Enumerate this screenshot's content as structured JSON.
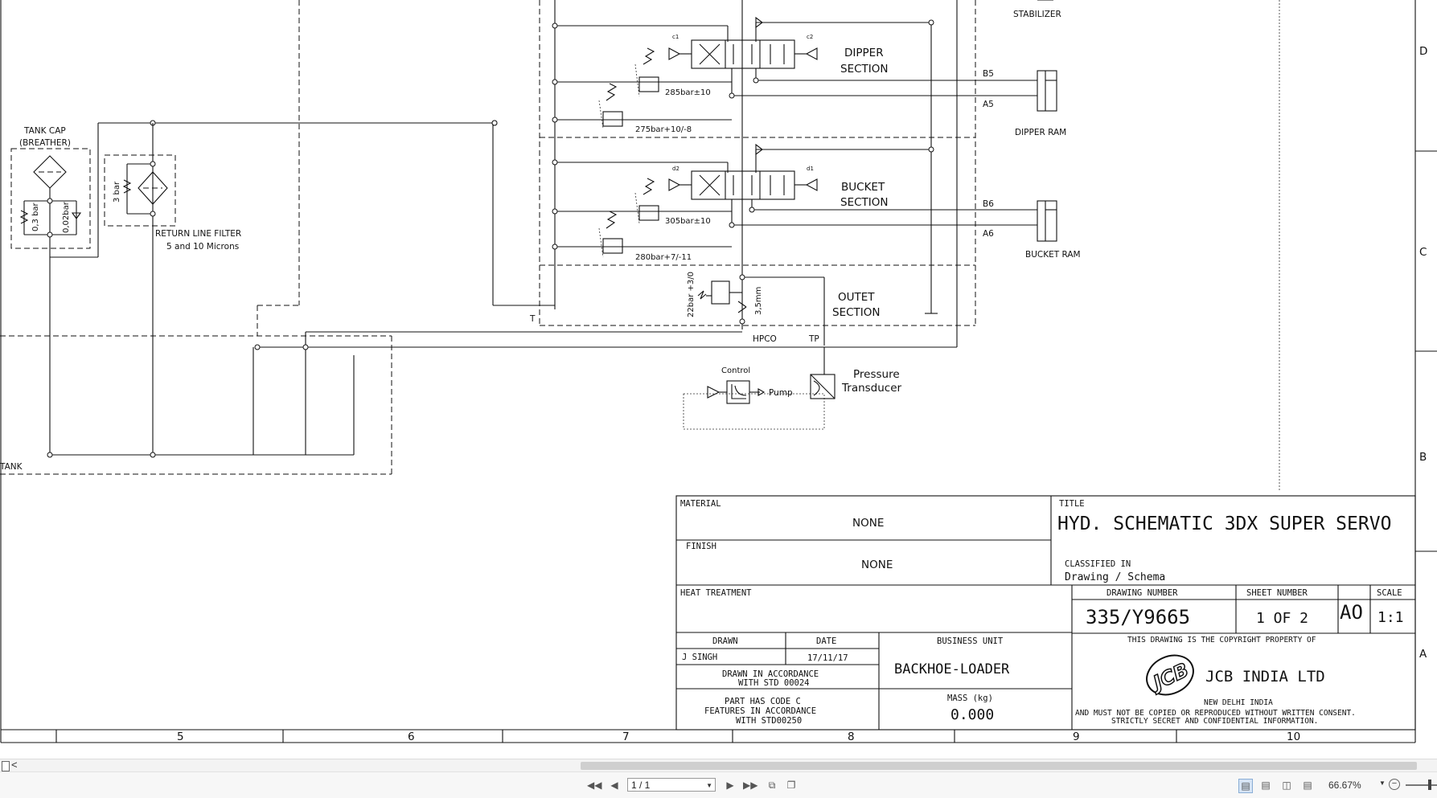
{
  "schematic": {
    "labels": {
      "stabilizer": "STABILIZER",
      "dipper_section": [
        "DIPPER",
        "SECTION"
      ],
      "bucket_section": [
        "BUCKET",
        "SECTION"
      ],
      "outet_section": [
        "OUTET",
        "SECTION"
      ],
      "b5": "B5",
      "a5": "A5",
      "b6": "B6",
      "a6": "A6",
      "dipper_ram": "DIPPER   RAM",
      "bucket_ram": "BUCKET   RAM",
      "relief_285": "285bar±10",
      "relief_275": "275bar+10/-8",
      "relief_305": "305bar±10",
      "relief_280": "280bar+7/-11",
      "relief_22": "22bar +3/0",
      "orifice": "3,5mm",
      "c1": "c1",
      "c2": "c2",
      "d1": "d1",
      "d2": "d2",
      "t_port": "T",
      "hpco": "HPCO",
      "tp": "TP",
      "control": "Control",
      "pump": "Pump",
      "pressure_transducer": [
        "Pressure",
        "Transducer"
      ],
      "tank_cap": [
        "TANK   CAP",
        "(BREATHER)"
      ],
      "bar_03": "0,3 bar",
      "bar_002": "0,02bar",
      "bar_3": "3 bar",
      "return_filter": [
        "RETURN   LINE  FILTER",
        "5 and  10  Microns"
      ],
      "tank": "TANK"
    }
  },
  "title_block": {
    "material_label": "MATERIAL",
    "material_value": "NONE",
    "finish_label": "FINISH",
    "finish_value": "NONE",
    "heat_treatment_label": "HEAT TREATMENT",
    "title_label": "TITLE",
    "title_value": "HYD. SCHEMATIC 3DX SUPER SERVO",
    "classified_label": "CLASSIFIED IN",
    "classified_value": "Drawing / Schema",
    "drawing_number_label": "DRAWING NUMBER",
    "drawing_number_value": "335/Y9665",
    "sheet_number_label": "SHEET NUMBER",
    "sheet_number_value": "1 OF 2",
    "size_value": "AO",
    "scale_label": "SCALE",
    "scale_value": "1:1",
    "drawn_label": "DRAWN",
    "drawn_value": "J SINGH",
    "date_label": "DATE",
    "date_value": "17/11/17",
    "business_unit_label": "BUSINESS UNIT",
    "business_unit_value": "BACKHOE-LOADER",
    "std_line1": "DRAWN IN ACCORDANCE",
    "std_line2": "WITH STD 00024",
    "part_code_line1": "PART HAS CODE C",
    "part_code_line2": "FEATURES IN ACCORDANCE",
    "part_code_line3": "WITH STD00250",
    "mass_label": "MASS (kg)",
    "mass_value": "0.000",
    "copyright_line1": "THIS DRAWING IS THE COPYRIGHT PROPERTY OF",
    "company": "JCB INDIA LTD",
    "logo_text": "JCB",
    "location": "NEW DELHI  INDIA",
    "copyright_line2": "AND MUST NOT BE COPIED OR REPRODUCED WITHOUT WRITTEN CONSENT.",
    "copyright_line3": "STRICTLY SECRET AND CONFIDENTIAL INFORMATION."
  },
  "grid": {
    "columns": [
      "5",
      "6",
      "7",
      "8",
      "9",
      "10"
    ],
    "rows": [
      "D",
      "C",
      "B",
      "A"
    ]
  },
  "viewer": {
    "scroll_left_glyph": "<",
    "page_value": "1 / 1",
    "zoom_value": "66.67%",
    "zoom_out_glyph": "−"
  }
}
